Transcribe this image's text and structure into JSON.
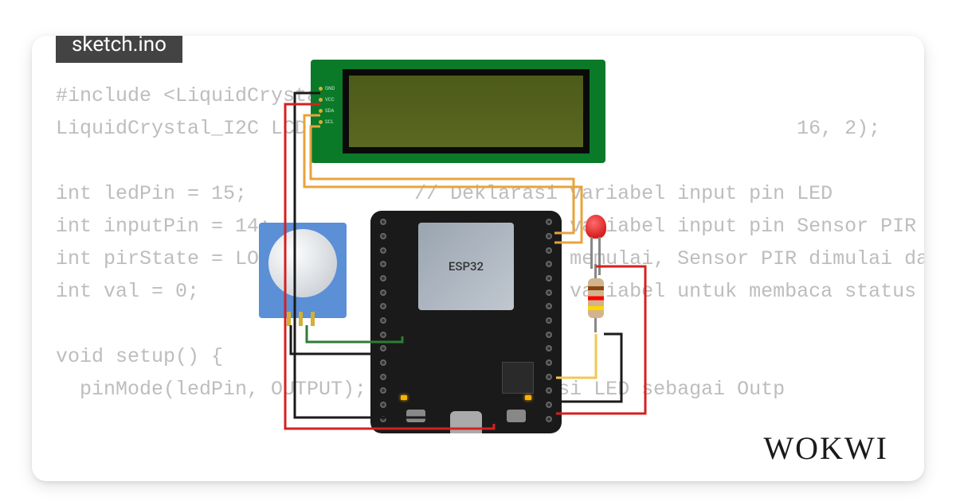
{
  "tab_title": "sketch.ino",
  "logo": "WOKWI",
  "code_lines": [
    "#include <LiquidCrystal_",
    "LiquidCrystal_I2C LCD =                                       16, 2);",
    "",
    "int ledPin = 15;              // Deklarasi variabel input pin LED",
    "int inputPin = 14;            // Deklarasi variabel input pin Sensor PIR",
    "int pirState = LOW;           // Pada saat memulai, Sensor PIR dimulai dar",
    "int val = 0;                  // Deklarasi variabel untuk membaca status pin",
    "",
    "void setup() {",
    "  pinMode(ledPin, OUTPUT);      // Deklarasi LED sebagai Outp"
  ],
  "lcd": {
    "pins": [
      "GND",
      "VCC",
      "SDA",
      "SCL"
    ]
  },
  "esp32": {
    "chip_label": "ESP32"
  },
  "components": {
    "pir": "PIR Motion Sensor",
    "led": "Red LED",
    "resistor": "Resistor",
    "lcd": "LCD 1602 I2C"
  },
  "wire_colors": {
    "gnd": "#1a1a1a",
    "vcc": "#d62020",
    "sda": "#e8a33d",
    "scl": "#e8a33d",
    "sig_green": "#2e7d32",
    "sig_yellow": "#f2c94c"
  }
}
